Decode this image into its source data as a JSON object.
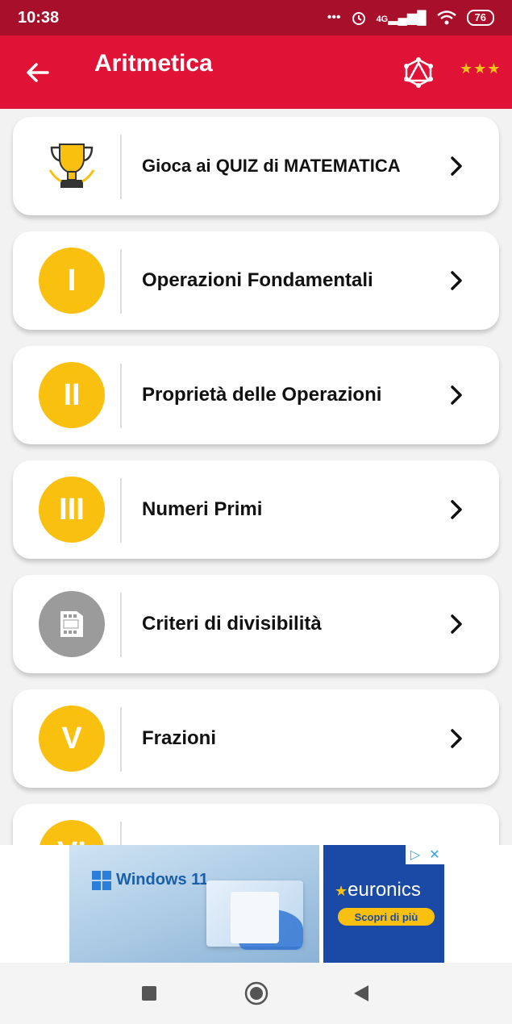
{
  "status_bar": {
    "time": "10:38",
    "network": "4G",
    "battery": "76"
  },
  "app_bar": {
    "title": "Aritmetica",
    "rating_stars": 3
  },
  "menu_items": [
    {
      "icon": "trophy-icon",
      "badge": "",
      "label": "Gioca ai QUIZ di MATEMATICA"
    },
    {
      "icon": "roman-numeral",
      "badge": "I",
      "label": "Operazioni Fondamentali"
    },
    {
      "icon": "roman-numeral",
      "badge": "II",
      "label": "Proprietà delle Operazioni"
    },
    {
      "icon": "roman-numeral",
      "badge": "III",
      "label": "Numeri Primi"
    },
    {
      "icon": "film-icon",
      "badge": "",
      "label": "Criteri di divisibilità"
    },
    {
      "icon": "roman-numeral",
      "badge": "V",
      "label": "Frazioni"
    },
    {
      "icon": "roman-numeral",
      "badge": "VI",
      "label": ""
    }
  ],
  "ad": {
    "left_text": "Windows 11",
    "brand": "euronics",
    "cta": "Scopri di più"
  },
  "colors": {
    "status_bar": "#a80f2a",
    "app_bar": "#e01337",
    "badge": "#f9c010",
    "badge_disabled": "#9b9b9b"
  }
}
